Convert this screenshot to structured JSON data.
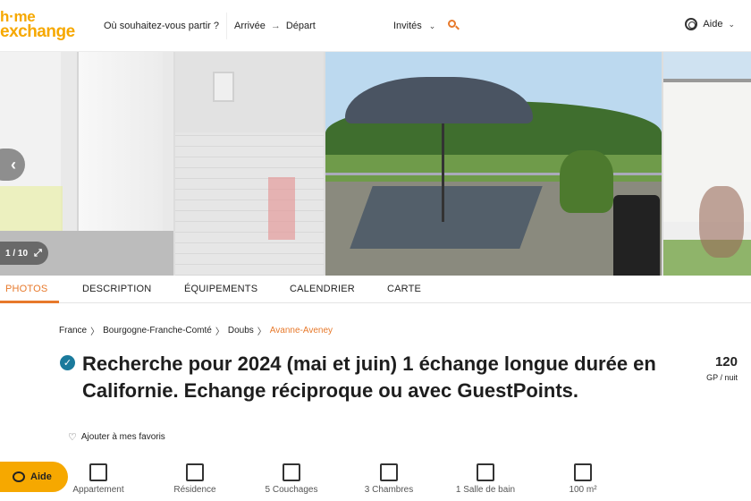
{
  "header": {
    "logo_line1": "h·me",
    "logo_line2": "exchange",
    "search_destination": "Où souhaitez-vous partir ?",
    "arrival": "Arrivée",
    "departure": "Départ",
    "guests": "Invités",
    "help": "Aide"
  },
  "gallery": {
    "counter": "1 / 10",
    "prev_icon": "‹",
    "expand_icon": "⤢"
  },
  "tabs": [
    "PHOTOS",
    "DESCRIPTION",
    "ÉQUIPEMENTS",
    "CALENDRIER",
    "CARTE"
  ],
  "breadcrumb": [
    "France",
    "Bourgogne-Franche-Comté",
    "Doubs",
    "Avanne-Aveney"
  ],
  "listing": {
    "title": "Recherche pour 2024 (mai et juin) 1 échange longue durée en Californie. Echange réciproque ou avec GuestPoints.",
    "price_value": "120",
    "price_unit": "GP / nuit",
    "favorite": "Ajouter à mes favoris",
    "verified_icon": "✓"
  },
  "features": [
    {
      "label": "Appartement",
      "icon": "apartment-icon"
    },
    {
      "label": "Résidence",
      "icon": "residence-icon"
    },
    {
      "label": "5 Couchages",
      "icon": "bed-icon"
    },
    {
      "label": "3 Chambres",
      "icon": "door-icon"
    },
    {
      "label": "1 Salle de bain",
      "icon": "bath-icon"
    },
    {
      "label": "100 m²",
      "icon": "area-icon"
    }
  ],
  "chat": {
    "label": "Aide"
  },
  "colors": {
    "brand_orange": "#e7792b",
    "brand_yellow": "#f6a800",
    "verified_teal": "#1a7a9c"
  }
}
